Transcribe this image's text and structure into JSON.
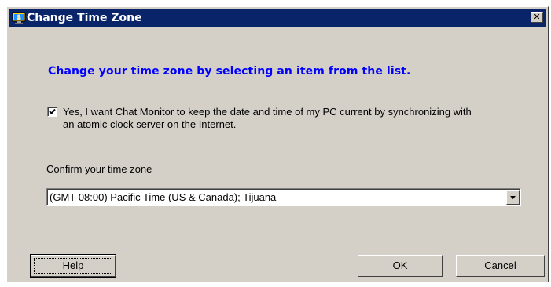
{
  "window": {
    "title": "Change Time Zone",
    "close_label": "✕"
  },
  "content": {
    "heading": "Change your time zone by selecting an item from the list.",
    "sync_checkbox_checked": true,
    "sync_text": "Yes, I want Chat Monitor to keep the date and time of my PC current by synchronizing with an atomic clock server on the Internet.",
    "confirm_label": "Confirm your time zone",
    "timezone_selected": "(GMT-08:00) Pacific Time (US & Canada); Tijuana"
  },
  "buttons": {
    "help": "Help",
    "ok": "OK",
    "cancel": "Cancel"
  },
  "colors": {
    "titlebar": "#0a246a",
    "dialog_bg": "#d4d0c8",
    "heading": "#0000ff"
  },
  "icons": {
    "title": "monitor-person-icon",
    "close": "close-icon",
    "dropdown": "chevron-down-icon",
    "check": "checkmark-icon"
  }
}
